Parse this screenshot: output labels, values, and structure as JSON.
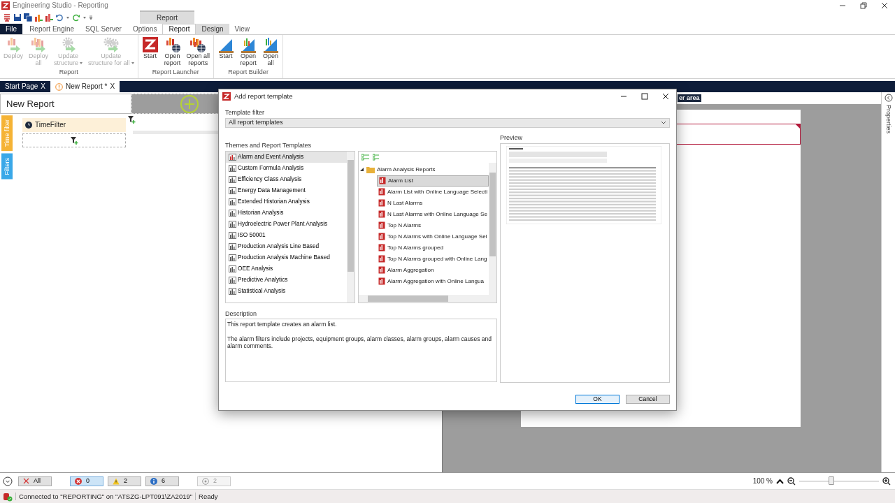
{
  "window": {
    "title": "Engineering Studio - Reporting"
  },
  "ribbon": {
    "context_group": "Report",
    "tabs": [
      {
        "label": "File",
        "kind": "file",
        "selected": false
      },
      {
        "label": "Report Engine",
        "kind": "plain",
        "selected": false
      },
      {
        "label": "SQL Server",
        "kind": "plain",
        "selected": false
      },
      {
        "label": "Options",
        "kind": "plain",
        "selected": false
      },
      {
        "label": "Report",
        "kind": "context",
        "selected": true
      },
      {
        "label": "Design",
        "kind": "context",
        "selected": false
      },
      {
        "label": "View",
        "kind": "plain",
        "selected": false
      }
    ],
    "groups": [
      {
        "label": "Report",
        "buttons": [
          {
            "kind": "deploy",
            "label": "Deploy",
            "disabled": true,
            "dropdown": false
          },
          {
            "kind": "deploy_all",
            "label": "Deploy\nall",
            "disabled": true,
            "dropdown": false
          },
          {
            "kind": "update",
            "label": "Update\nstructure",
            "disabled": true,
            "dropdown": true
          },
          {
            "kind": "update_all",
            "label": "Update\nstructure for all",
            "disabled": true,
            "dropdown": true
          }
        ]
      },
      {
        "label": "Report Launcher",
        "buttons": [
          {
            "kind": "launcher_start",
            "label": "Start",
            "disabled": false,
            "dropdown": false
          },
          {
            "kind": "open_report",
            "label": "Open\nreport",
            "disabled": false,
            "dropdown": false
          },
          {
            "kind": "open_all",
            "label": "Open all\nreports",
            "disabled": false,
            "dropdown": false
          }
        ]
      },
      {
        "label": "Report Builder",
        "buttons": [
          {
            "kind": "builder_start",
            "label": "Start",
            "disabled": false,
            "dropdown": false
          },
          {
            "kind": "builder_open",
            "label": "Open\nreport",
            "disabled": false,
            "dropdown": false
          },
          {
            "kind": "builder_open_all",
            "label": "Open\nall",
            "disabled": false,
            "dropdown": false
          }
        ]
      }
    ]
  },
  "doc_tabs": [
    {
      "label": "Start Page",
      "close": "X",
      "selected": false,
      "warning": false
    },
    {
      "label": "New Report *",
      "close": "X",
      "selected": true,
      "warning": true
    }
  ],
  "report_panel": {
    "title": "New Report",
    "side_tabs": [
      {
        "label": "Time filter",
        "color": "#f5b335"
      },
      {
        "label": "Filters",
        "color": "#3aa8e8"
      }
    ],
    "filter_item": "TimeFilter"
  },
  "canvas": {
    "area_label": "er area"
  },
  "properties_tab": "Properties",
  "dialog": {
    "title": "Add report template",
    "template_filter_label": "Template filter",
    "template_filter_value": "All report templates",
    "themes_label": "Themes and Report Templates",
    "themes": [
      {
        "label": "Alarm and Event Analysis",
        "selected": true
      },
      {
        "label": "Custom Formula Analysis",
        "selected": false
      },
      {
        "label": "Efficiency Class Analysis",
        "selected": false
      },
      {
        "label": "Energy Data Management",
        "selected": false
      },
      {
        "label": "Extended Historian Analysis",
        "selected": false
      },
      {
        "label": "Historian Analysis",
        "selected": false
      },
      {
        "label": "Hydroelectric Power Plant Analysis",
        "selected": false
      },
      {
        "label": "ISO 50001",
        "selected": false
      },
      {
        "label": "Production Analysis Line Based",
        "selected": false
      },
      {
        "label": "Production Analysis Machine Based",
        "selected": false
      },
      {
        "label": "OEE Analysis",
        "selected": false
      },
      {
        "label": "Predictive Analytics",
        "selected": false
      },
      {
        "label": "Statistical Analysis",
        "selected": false
      }
    ],
    "tree": [
      {
        "label": "Alarm Analysis Reports",
        "expanded": true,
        "children": [
          {
            "label": "Alarm List",
            "selected": true
          },
          {
            "label": "Alarm List with Online Language Selecti",
            "selected": false
          },
          {
            "label": "N Last Alarms",
            "selected": false
          },
          {
            "label": "N Last Alarms with Online Language Se",
            "selected": false
          },
          {
            "label": "Top N Alarms",
            "selected": false
          },
          {
            "label": "Top N Alarms with Online Language Sel",
            "selected": false
          },
          {
            "label": "Top N Alarms grouped",
            "selected": false
          },
          {
            "label": "Top N Alarms grouped with Online Lang",
            "selected": false
          },
          {
            "label": "Alarm Aggregation",
            "selected": false
          },
          {
            "label": "Alarm Aggregation with Online Langua",
            "selected": false
          }
        ]
      }
    ],
    "preview_label": "Preview",
    "description_label": "Description",
    "description": [
      "This report template creates an alarm list.",
      "The alarm filters include projects, equipment groups, alarm classes, alarm groups, alarm causes and alarm comments."
    ],
    "buttons": [
      {
        "label": "OK",
        "default": true
      },
      {
        "label": "Cancel",
        "default": false
      }
    ]
  },
  "message_filters": [
    {
      "kind": "all",
      "label": "All",
      "selected": false,
      "disabled": false
    },
    {
      "kind": "error",
      "label": "0",
      "selected": true,
      "disabled": false
    },
    {
      "kind": "warning",
      "label": "2",
      "selected": false,
      "disabled": false
    },
    {
      "kind": "info",
      "label": "6",
      "selected": false,
      "disabled": false
    },
    {
      "kind": "hidden",
      "label": "2",
      "selected": false,
      "disabled": true
    }
  ],
  "zoom": {
    "reading": "100 %",
    "level": 0.4
  },
  "status_bar": {
    "connection": "Connected to \"REPORTING\" on \"ATSZG-LPT091\\ZA2019\"",
    "state": "Ready"
  }
}
